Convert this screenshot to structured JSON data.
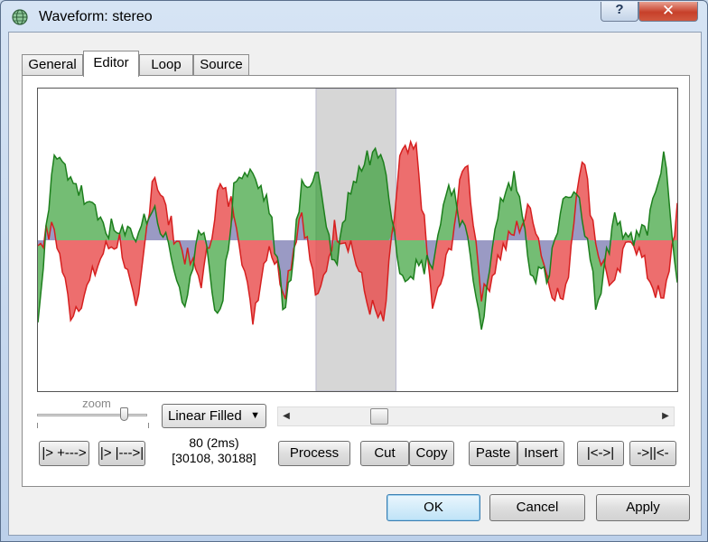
{
  "window": {
    "title": "Waveform: stereo",
    "help_label": "?",
    "close_label": "✕"
  },
  "tabs": [
    {
      "label": "General",
      "active": false
    },
    {
      "label": "Editor",
      "active": true
    },
    {
      "label": "Loop",
      "active": false
    },
    {
      "label": "Source",
      "active": false
    }
  ],
  "editor": {
    "zoom_label": "zoom",
    "zoom_level": 0.82,
    "render_mode": "Linear Filled",
    "scroll_position": 0.22,
    "selection": {
      "start": 0.435,
      "end": 0.56
    },
    "position_text": "80 (2ms)",
    "range_text": "[30108, 30188]",
    "buttons": {
      "go_left": "|> +--->",
      "go_right": "|> |--->|",
      "process": "Process",
      "cut": "Cut",
      "copy": "Copy",
      "paste": "Paste",
      "insert": "Insert",
      "zoom_selection": "|<->|",
      "zoom_all": "->||<-"
    },
    "colors": {
      "left_channel": "#e84a4a",
      "right_channel": "#2a9a2a",
      "overlap": "#9a9ac4",
      "selection": "#d6d6d6"
    }
  },
  "dialog": {
    "ok": "OK",
    "cancel": "Cancel",
    "apply": "Apply"
  }
}
